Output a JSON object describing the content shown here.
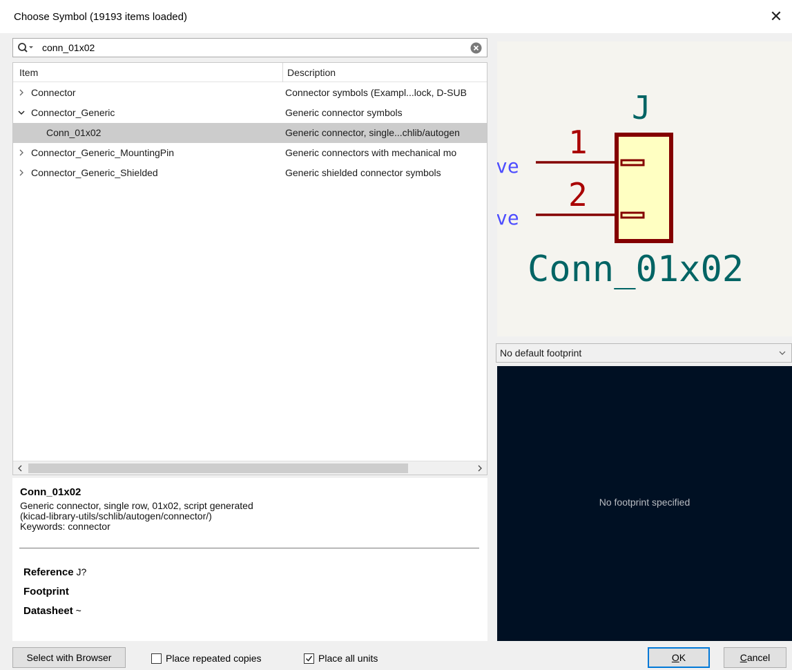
{
  "window": {
    "title": "Choose Symbol (19193 items loaded)",
    "close_glyph": "✕"
  },
  "search": {
    "value": "conn_01x02"
  },
  "tree": {
    "columns": [
      "Item",
      "Description"
    ],
    "rows": [
      {
        "name": "Connector",
        "description": "Connector symbols (Exampl...lock, D-SUB",
        "expanded": false,
        "selected": false,
        "level": 0
      },
      {
        "name": "Connector_Generic",
        "description": "Generic connector symbols",
        "expanded": true,
        "selected": false,
        "level": 0
      },
      {
        "name": "Conn_01x02",
        "description": "Generic connector, single...chlib/autogen",
        "expanded": false,
        "selected": true,
        "level": 1
      },
      {
        "name": "Connector_Generic_MountingPin",
        "description": "Generic connectors with mechanical mo",
        "expanded": false,
        "selected": false,
        "level": 0
      },
      {
        "name": "Connector_Generic_Shielded",
        "description": "Generic shielded connector symbols",
        "expanded": false,
        "selected": false,
        "level": 0
      }
    ]
  },
  "details": {
    "symbol_name": "Conn_01x02",
    "description_lines": [
      "Generic connector, single row, 01x02, script generated",
      "(kicad-library-utils/schlib/autogen/connector/)",
      "Keywords: connector"
    ],
    "fields": [
      {
        "label": "Reference",
        "value": "J?"
      },
      {
        "label": "Footprint",
        "value": ""
      },
      {
        "label": "Datasheet",
        "value": "~"
      }
    ]
  },
  "preview": {
    "reference": "J",
    "value": "Conn_01x02",
    "pin_numbers": [
      "1",
      "2"
    ],
    "pin_type_fragment": "ve",
    "colors": {
      "background": "#f5f4ef",
      "body_outline": "#840000",
      "body_fill": "#ffffc2",
      "text": "#006464",
      "pin_number": "#a90000",
      "pin_name": "#4d4dff"
    }
  },
  "footprint": {
    "selector_value": "No default footprint",
    "empty_message": "No footprint specified",
    "background": "#001023"
  },
  "footer": {
    "browser_button": "Select with Browser",
    "repeated_copies_label": "Place repeated copies",
    "repeated_copies_checked": false,
    "all_units_label": "Place all units",
    "all_units_checked": true,
    "ok_mnemonic": "O",
    "ok_rest": "K",
    "cancel_mnemonic": "C",
    "cancel_rest": "ancel"
  }
}
